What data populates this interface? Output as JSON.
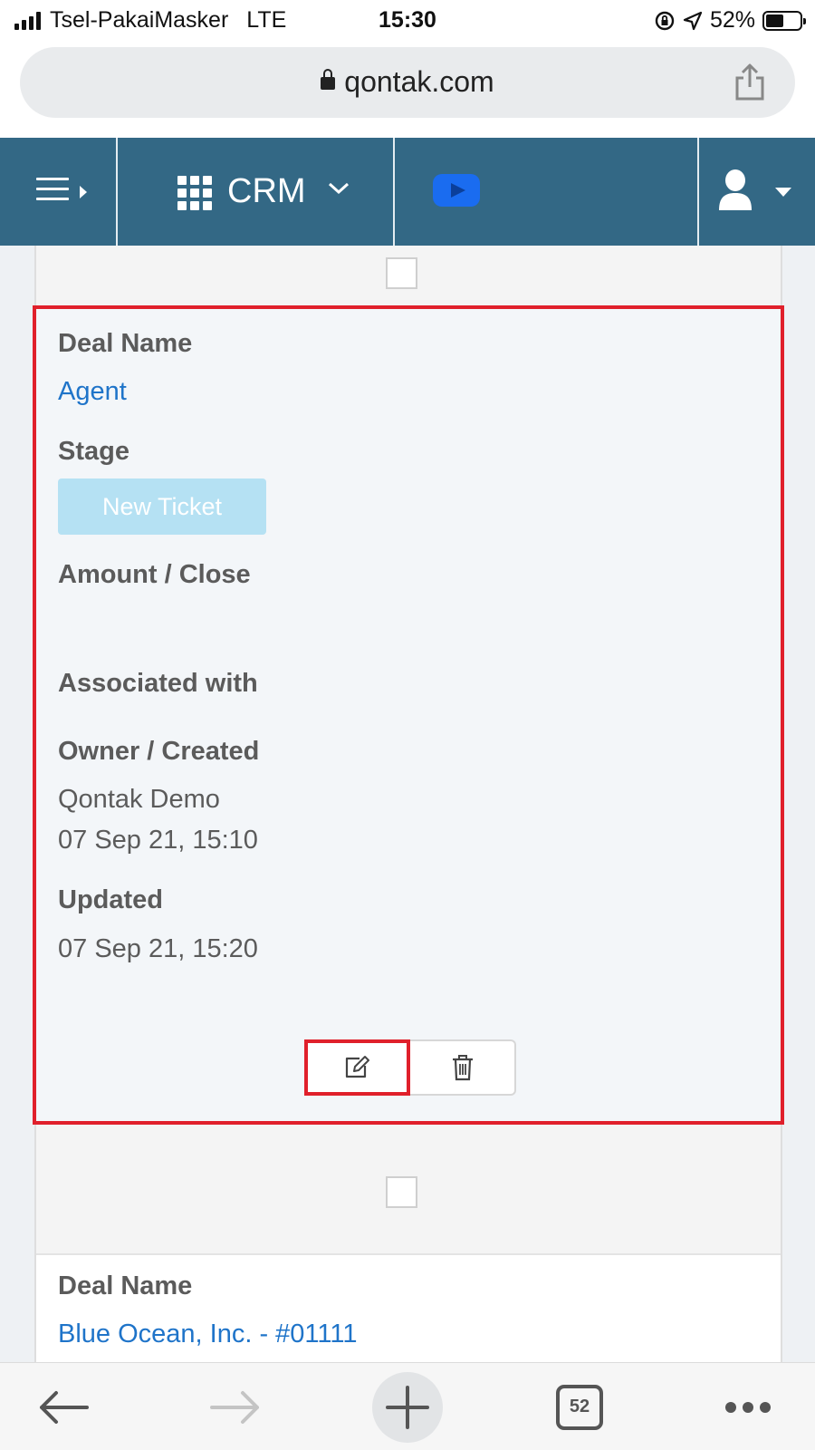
{
  "status_bar": {
    "carrier": "Tsel-PakaiMasker",
    "network": "LTE",
    "time": "15:30",
    "battery": "52%",
    "battery_level": 0.52
  },
  "browser": {
    "url": "qontak.com",
    "tab_count": "52"
  },
  "app_nav": {
    "module_label": "CRM"
  },
  "deal_card": {
    "labels": {
      "deal_name": "Deal Name",
      "stage": "Stage",
      "amount_close": "Amount / Close",
      "associated_with": "Associated with",
      "owner_created": "Owner / Created",
      "updated": "Updated"
    },
    "deal_name": "Agent",
    "stage": "New Ticket",
    "owner": "Qontak Demo",
    "created": "07 Sep 21, 15:10",
    "updated": "07 Sep 21, 15:20"
  },
  "next_deal_card": {
    "label": "Deal Name",
    "deal_name": "Blue Ocean, Inc. - #01111"
  },
  "colors": {
    "nav": "#336885",
    "link": "#1f74c9",
    "highlight": "#e0202b",
    "stage_badge": "#b5e1f3"
  }
}
